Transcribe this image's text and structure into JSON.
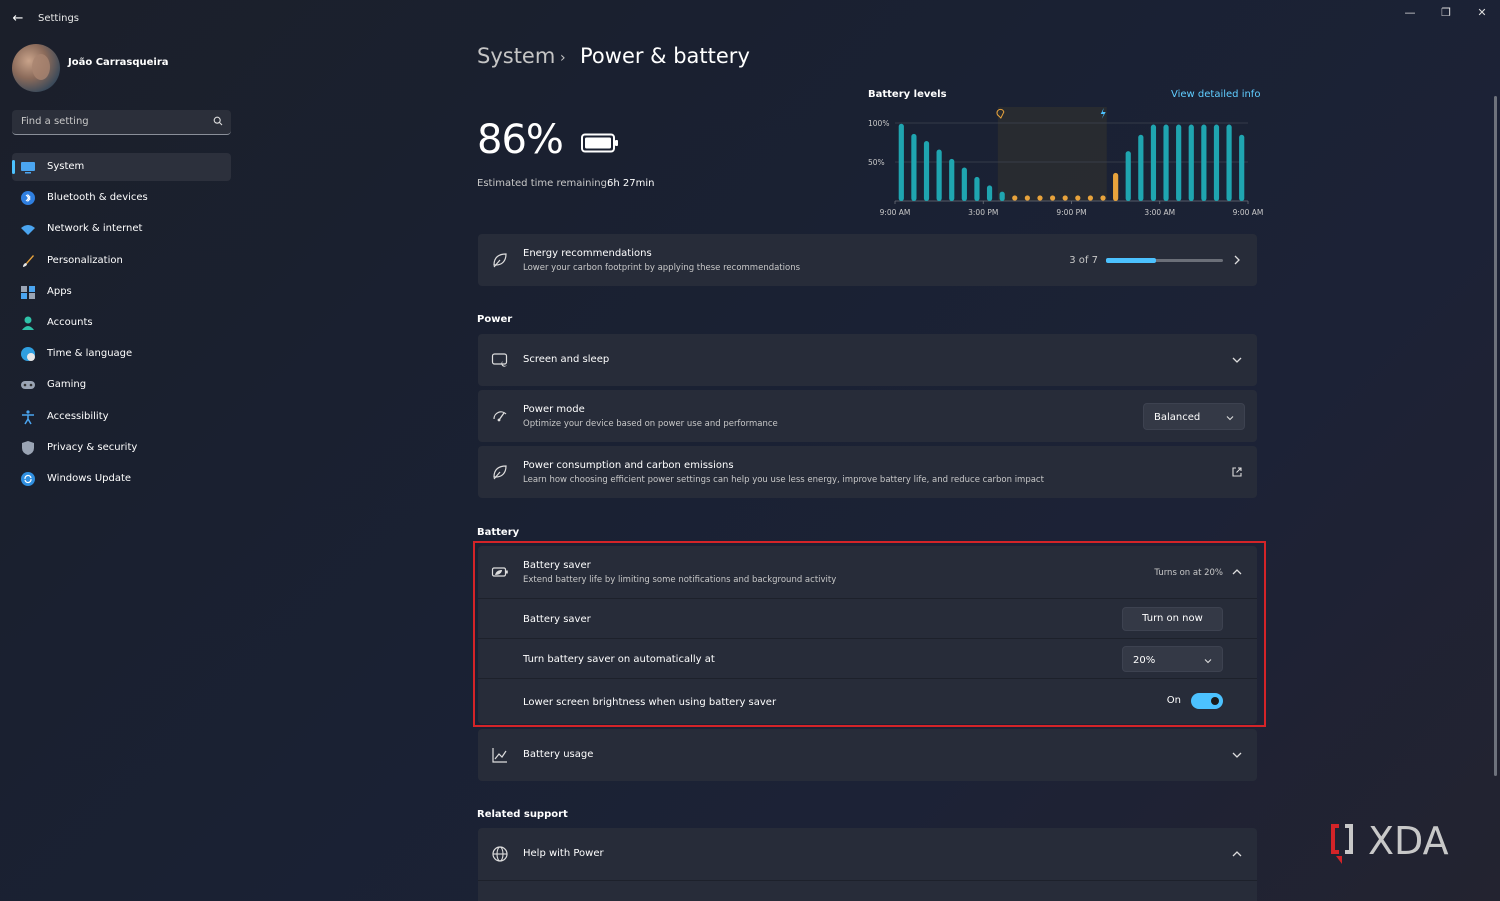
{
  "window": {
    "app_title": "Settings",
    "controls": {
      "minimize": "—",
      "restore": "❐",
      "close": "✕"
    }
  },
  "user": {
    "name": "João Carrasqueira"
  },
  "search": {
    "placeholder": "Find a setting"
  },
  "nav": [
    {
      "label": "System",
      "icon": "monitor-icon",
      "active": true
    },
    {
      "label": "Bluetooth & devices",
      "icon": "bluetooth-icon"
    },
    {
      "label": "Network & internet",
      "icon": "wifi-icon"
    },
    {
      "label": "Personalization",
      "icon": "brush-icon"
    },
    {
      "label": "Apps",
      "icon": "apps-icon"
    },
    {
      "label": "Accounts",
      "icon": "person-icon"
    },
    {
      "label": "Time & language",
      "icon": "globe-clock-icon"
    },
    {
      "label": "Gaming",
      "icon": "gamepad-icon"
    },
    {
      "label": "Accessibility",
      "icon": "accessibility-icon"
    },
    {
      "label": "Privacy & security",
      "icon": "shield-icon"
    },
    {
      "label": "Windows Update",
      "icon": "update-icon"
    }
  ],
  "breadcrumb": {
    "parent": "System",
    "separator": "›",
    "current": "Power & battery"
  },
  "battery": {
    "percent": "86%",
    "estimated_label": "Estimated time remaining:",
    "estimated_value": "6h 27min"
  },
  "chart": {
    "title": "Battery levels",
    "link": "View detailed info"
  },
  "chart_data": {
    "type": "bar",
    "title": "Battery levels",
    "y_ticks": [
      "100%",
      "50%"
    ],
    "x_ticks": [
      "9:00 AM",
      "3:00 PM",
      "9:00 PM",
      "3:00 AM",
      "9:00 AM"
    ],
    "ylim": [
      0,
      100
    ],
    "bar_color": "#1fa5b0",
    "low_color": "#e8a33c",
    "values": [
      99,
      86,
      77,
      66,
      54,
      43,
      31,
      20,
      12,
      4,
      4,
      4,
      4,
      4,
      4,
      4,
      4,
      36,
      64,
      85,
      98,
      98,
      98,
      98,
      98,
      98,
      98,
      85
    ],
    "charging_markers": [
      8,
      16
    ],
    "series": [
      {
        "values": [
          99,
          86,
          77,
          66,
          54,
          43,
          31,
          20,
          12,
          4,
          4,
          4,
          4,
          4,
          4,
          4,
          4,
          36,
          64,
          85,
          98,
          98,
          98,
          98,
          98,
          98,
          98,
          85
        ]
      }
    ]
  },
  "energy": {
    "title": "Energy recommendations",
    "subtitle": "Lower your carbon footprint by applying these recommendations",
    "count": "3 of 7",
    "progress": 0.43
  },
  "power": {
    "section": "Power",
    "screen_sleep": {
      "title": "Screen and sleep"
    },
    "power_mode": {
      "title": "Power mode",
      "subtitle": "Optimize your device based on power use and performance",
      "value": "Balanced"
    },
    "consumption": {
      "title": "Power consumption and carbon emissions",
      "subtitle": "Learn how choosing efficient power settings can help you use less energy, improve battery life, and reduce carbon impact"
    }
  },
  "battery_section": {
    "section": "Battery",
    "saver": {
      "title": "Battery saver",
      "subtitle": "Extend battery life by limiting some notifications and background activity",
      "status": "Turns on at 20%",
      "row_saver_label": "Battery saver",
      "row_saver_button": "Turn on now",
      "row_auto_label": "Turn battery saver on automatically at",
      "row_auto_value": "20%",
      "row_brightness_label": "Lower screen brightness when using battery saver",
      "row_brightness_state": "On"
    },
    "usage": {
      "title": "Battery usage"
    }
  },
  "related": {
    "section": "Related support",
    "help": {
      "title": "Help with Power"
    }
  },
  "watermark": {
    "text": "XDA"
  },
  "colors": {
    "accent": "#4cc2ff",
    "highlight": "#d42428",
    "card": "#272c39"
  }
}
